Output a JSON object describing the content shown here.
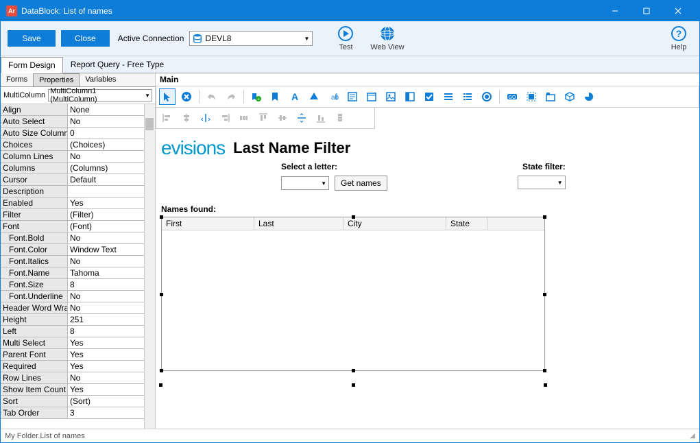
{
  "titlebar": {
    "icon_text": "Ar",
    "title": "DataBlock: List of names"
  },
  "toolbar": {
    "save": "Save",
    "close": "Close",
    "connection_label": "Active Connection",
    "connection_value": "DEVL8",
    "test": "Test",
    "webview": "Web View",
    "help": "Help"
  },
  "top_tabs": {
    "form_design": "Form Design",
    "report_query": "Report Query - Free Type"
  },
  "sub_tabs": {
    "forms": "Forms",
    "properties": "Properties",
    "variables": "Variables"
  },
  "prop_selector": {
    "label": "MultiColumn",
    "value": "MultiColumn1 (MultiColumn)"
  },
  "properties": [
    {
      "name": "Align",
      "value": "None"
    },
    {
      "name": "Auto Select",
      "value": "No"
    },
    {
      "name": "Auto Size Columns",
      "value": "0"
    },
    {
      "name": "Choices",
      "value": "(Choices)"
    },
    {
      "name": "Column Lines",
      "value": "No"
    },
    {
      "name": "Columns",
      "value": "(Columns)"
    },
    {
      "name": "Cursor",
      "value": "Default"
    },
    {
      "name": "Description",
      "value": ""
    },
    {
      "name": "Enabled",
      "value": "Yes"
    },
    {
      "name": "Filter",
      "value": "(Filter)"
    },
    {
      "name": "Font",
      "value": "(Font)"
    },
    {
      "name": "Font.Bold",
      "value": "No",
      "indent": true
    },
    {
      "name": "Font.Color",
      "value": "Window Text",
      "indent": true
    },
    {
      "name": "Font.Italics",
      "value": "No",
      "indent": true
    },
    {
      "name": "Font.Name",
      "value": "Tahoma",
      "indent": true
    },
    {
      "name": "Font.Size",
      "value": "8",
      "indent": true
    },
    {
      "name": "Font.Underline",
      "value": "No",
      "indent": true
    },
    {
      "name": "Header Word Wrap",
      "value": "No"
    },
    {
      "name": "Height",
      "value": "251"
    },
    {
      "name": "Left",
      "value": "8"
    },
    {
      "name": "Multi Select",
      "value": "Yes"
    },
    {
      "name": "Parent Font",
      "value": "Yes"
    },
    {
      "name": "Required",
      "value": "Yes"
    },
    {
      "name": "Row Lines",
      "value": "No"
    },
    {
      "name": "Show Item Count",
      "value": "Yes"
    },
    {
      "name": "Sort",
      "value": "(Sort)"
    },
    {
      "name": "Tab Order",
      "value": "3"
    }
  ],
  "canvas": {
    "label": "Main",
    "logo": "evisions",
    "title": "Last Name Filter",
    "select_letter": "Select a letter:",
    "get_names": "Get names",
    "state_filter": "State filter:",
    "names_found": "Names found:",
    "columns": [
      "First",
      "Last",
      "City",
      "State"
    ]
  },
  "statusbar": {
    "path": "My Folder.List of names"
  }
}
